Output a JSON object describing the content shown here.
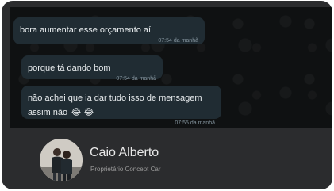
{
  "messages": [
    {
      "text": "bora aumentar esse orçamento aí",
      "time": "07:54 da manhã"
    },
    {
      "text": "porque tá dando bom",
      "time": "07:54 da manhã"
    },
    {
      "text": "não achei que ia dar tudo isso de mensagem assim não",
      "emoji": "😂 😂",
      "time": "07:55 da manhã"
    }
  ],
  "profile": {
    "name": "Caio Alberto",
    "subtitle": "Proprietário Concept Car"
  }
}
